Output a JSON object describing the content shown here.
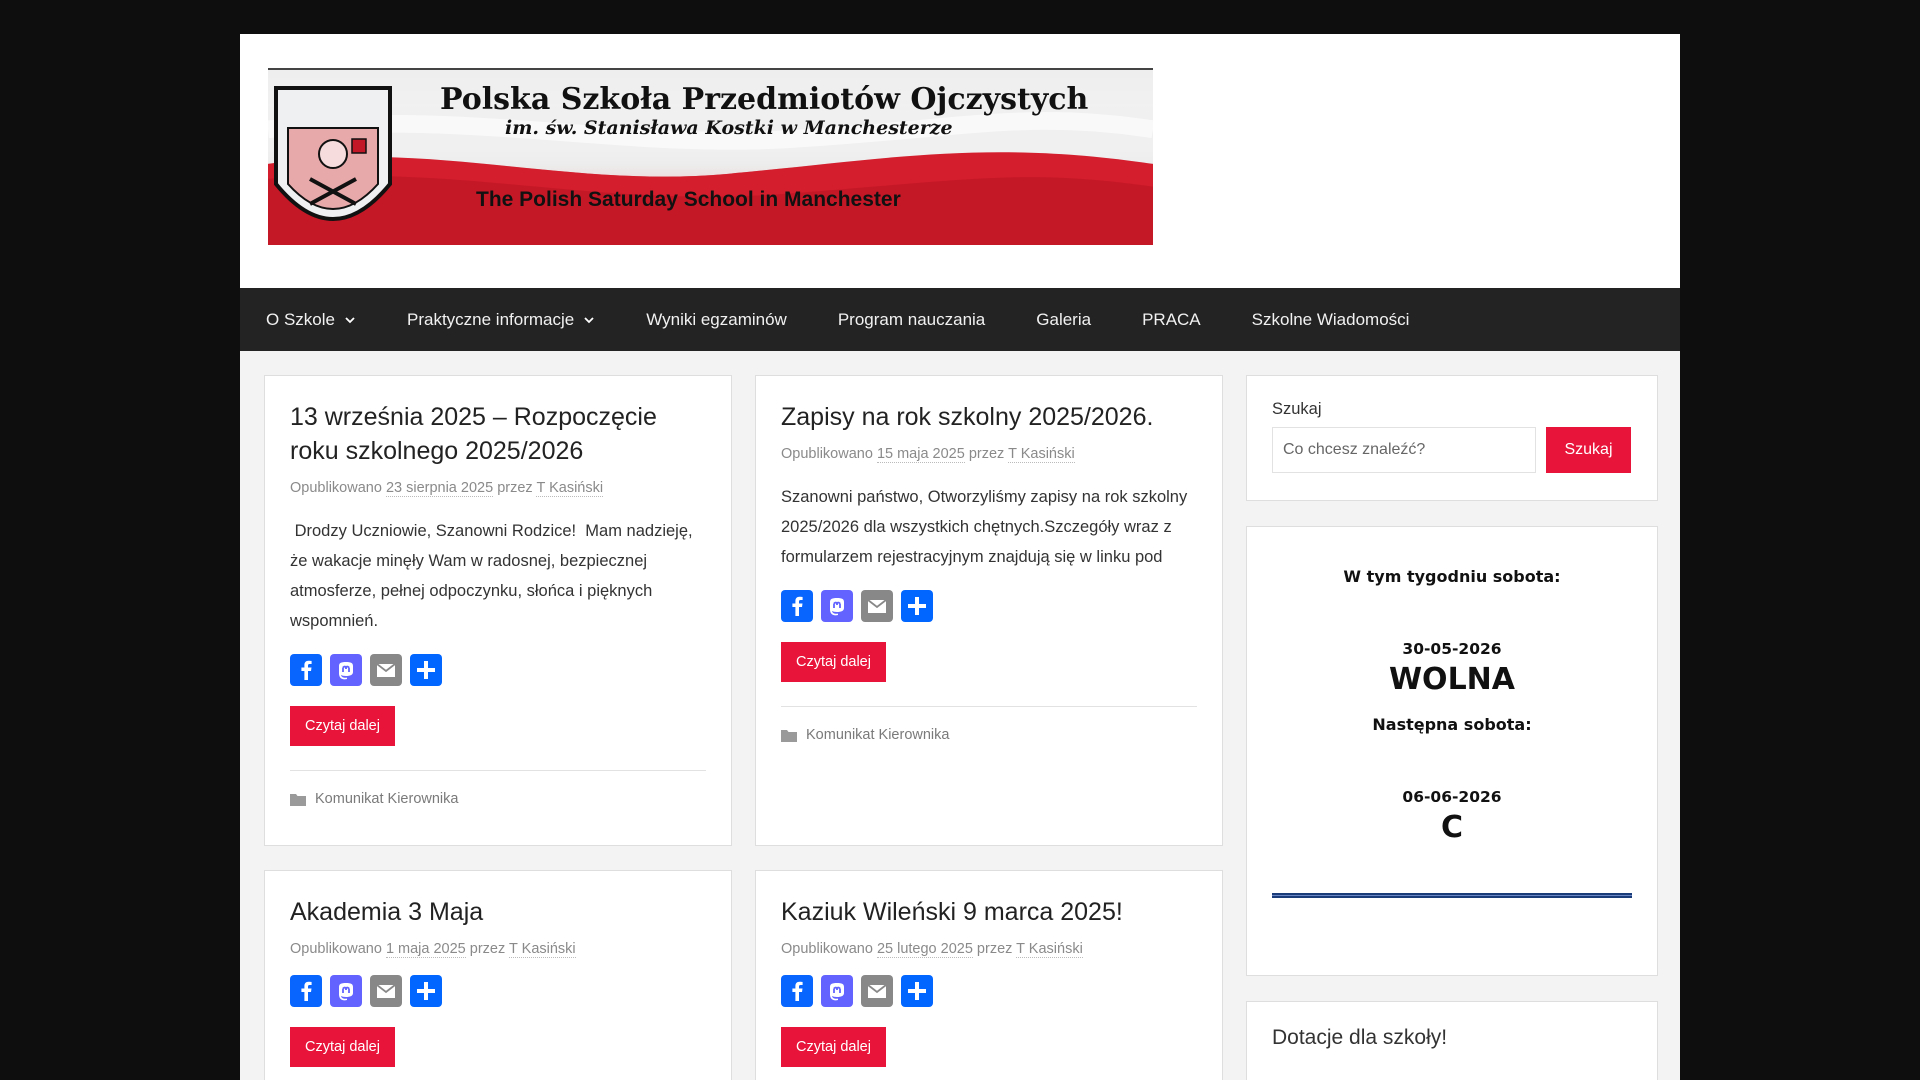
{
  "banner": {
    "title": "Polska Szkoła Przedmiotów Ojczystych",
    "subtitle": "im. św. Stanisława Kostki w Manchesterze",
    "english": "The Polish Saturday School in Manchester"
  },
  "nav": {
    "items": [
      {
        "label": "O Szkole",
        "dropdown": true
      },
      {
        "label": "Praktyczne informacje",
        "dropdown": true
      },
      {
        "label": "Wyniki egzaminów",
        "dropdown": false
      },
      {
        "label": "Program nauczania",
        "dropdown": false
      },
      {
        "label": "Galeria",
        "dropdown": false
      },
      {
        "label": "PRACA",
        "dropdown": false
      },
      {
        "label": "Szkolne Wiadomości",
        "dropdown": false
      }
    ]
  },
  "posts": [
    {
      "title": "13 września 2025 – Rozpoczęcie roku szkolnego 2025/2026",
      "meta_prefix": "Opublikowano",
      "date": "23 sierpnia 2025",
      "meta_by": "przez",
      "author": "T Kasiński",
      "excerpt": " Drodzy Uczniowie, Szanowni Rodzice!  Mam nadzieję, że wakacje minęły Wam w radosnej, bezpiecznej atmosferze, pełnej odpoczynku, słońca i pięknych wspomnień.",
      "read_more": "Czytaj dalej",
      "category": "Komunikat Kierownika"
    },
    {
      "title": "Zapisy na rok szkolny 2025/2026.",
      "meta_prefix": "Opublikowano",
      "date": "15 maja 2025",
      "meta_by": "przez",
      "author": "T Kasiński",
      "excerpt": "Szanowni państwo, Otworzyliśmy zapisy na rok szkolny 2025/2026 dla wszystkich chętnych.Szczegóły wraz z formularzem rejestracyjnym znajdują się w linku pod",
      "read_more": "Czytaj dalej",
      "category": "Komunikat Kierownika"
    },
    {
      "title": "Akademia 3 Maja",
      "meta_prefix": "Opublikowano",
      "date": "1 maja 2025",
      "meta_by": "przez",
      "author": "T Kasiński",
      "read_more": "Czytaj dalej"
    },
    {
      "title": "Kaziuk Wileński 9 marca 2025!",
      "meta_prefix": "Opublikowano",
      "date": "25 lutego 2025",
      "meta_by": "przez",
      "author": "T Kasiński",
      "read_more": "Czytaj dalej"
    }
  ],
  "share_icons": [
    {
      "name": "facebook-icon",
      "color": "#0866ff"
    },
    {
      "name": "mastodon-icon",
      "color": "#6364ff"
    },
    {
      "name": "email-icon",
      "color": "#888888"
    },
    {
      "name": "share-icon",
      "color": "#0166ff"
    }
  ],
  "sidebar": {
    "search": {
      "label": "Szukaj",
      "placeholder": "Co chcesz znaleźć?",
      "button": "Szukaj"
    },
    "saturday": {
      "this_week_label": "W tym tygodniu sobota:",
      "this_date": "30-05-2026",
      "this_status": "WOLNA",
      "next_label": "Następna sobota:",
      "next_date": "06-06-2026",
      "next_status": "C"
    },
    "donations": {
      "title": "Dotacje dla szkoły!"
    }
  },
  "colors": {
    "accent": "#e8143a",
    "nav_bg": "#232323",
    "page_bg": "#0e0e0e"
  }
}
